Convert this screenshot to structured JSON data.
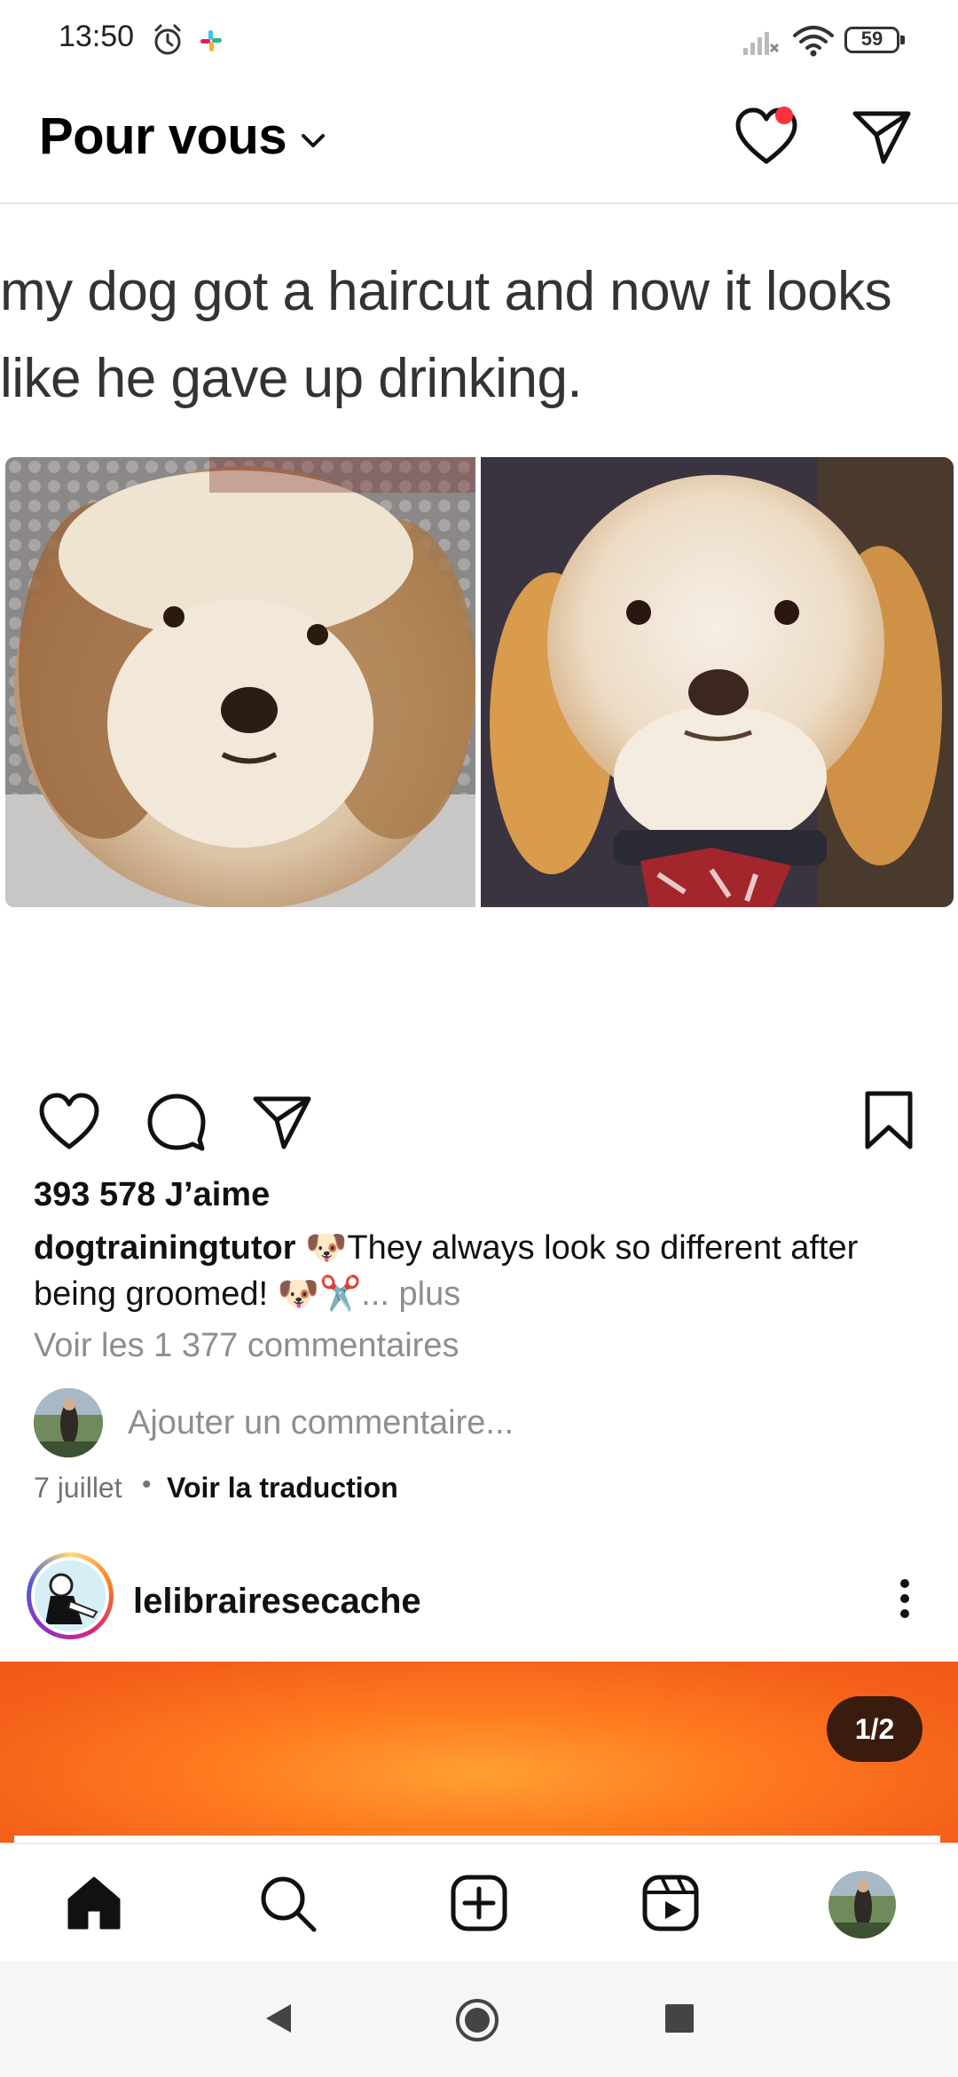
{
  "status_bar": {
    "time": "13:50",
    "battery": "59",
    "icons": [
      "alarm-icon",
      "slack-icon",
      "signal-icon",
      "wifi-icon",
      "battery-icon"
    ]
  },
  "header": {
    "title": "Pour vous",
    "icons": [
      "chevron-down-icon",
      "heart-icon",
      "send-icon"
    ],
    "notification_color": "#ff3040"
  },
  "post": {
    "meme_caption_line1": "my dog got a haircut and now it looks",
    "meme_caption_line2": "like he gave up drinking.",
    "likes": "393 578 J’aime",
    "username": "dogtrainingtutor",
    "emoji1": "🐶",
    "caption_text1": "They always look so different after",
    "caption_text2": "being groomed!",
    "emoji2": "🐶✂️",
    "more": "... plus",
    "view_comments": "Voir les 1 377 commentaires",
    "add_comment_placeholder": "Ajouter un commentaire...",
    "date": "7 juillet",
    "separator": "•",
    "translate": "Voir la traduction"
  },
  "next_post": {
    "username": "lelibrairesecache",
    "page_indicator": "1/2"
  },
  "bottom_nav": {
    "items": [
      "home-icon",
      "search-icon",
      "create-icon",
      "reels-icon",
      "profile-avatar"
    ]
  },
  "android_nav": {
    "items": [
      "back-button",
      "home-button",
      "recents-button"
    ]
  },
  "colors": {
    "accent_orange": "#f45f1a",
    "story_ring": "#d62976",
    "text_muted": "#8e8e8e"
  }
}
